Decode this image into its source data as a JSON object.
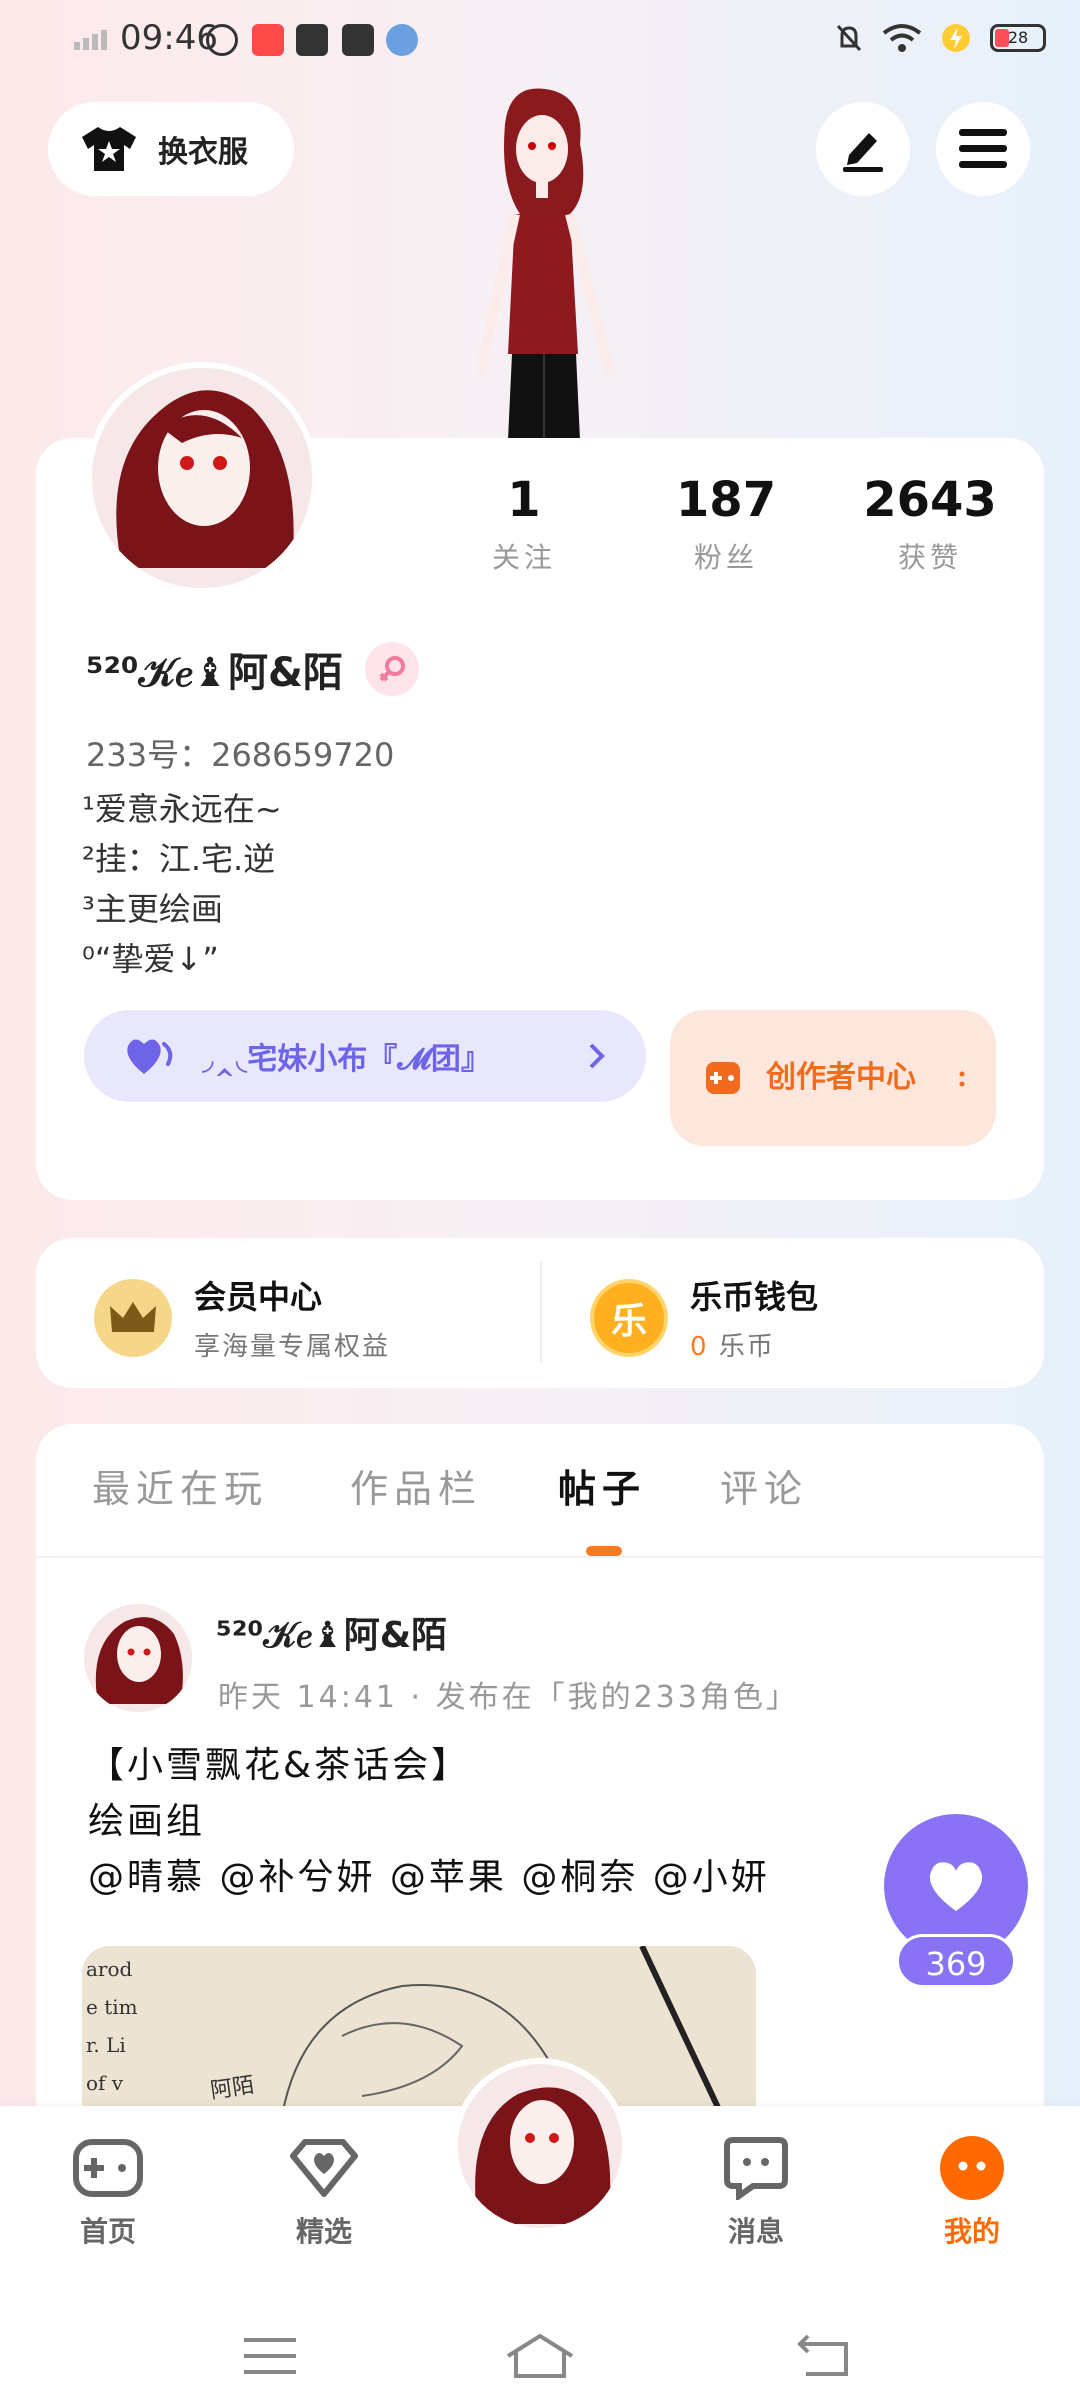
{
  "status_bar": {
    "time": "09:46",
    "battery": "28"
  },
  "header": {
    "dressup_label": "换衣服"
  },
  "profile": {
    "stats": [
      {
        "value": "1",
        "label": "关注"
      },
      {
        "value": "187",
        "label": "粉丝"
      },
      {
        "value": "2643",
        "label": "获赞"
      }
    ],
    "username": "⁵²⁰𝒦𝑒♝阿&陌",
    "uid": "233号：268659720",
    "bio": [
      "¹爱意永远在~",
      "²挂：江.宅.逆",
      "³主更绘画",
      "⁰“挚爱↓”"
    ],
    "group_label": "◞‸◟宅妹小布『𝓜团』",
    "creator_label": "创作者中心"
  },
  "member": {
    "vip_title": "会员中心",
    "vip_sub": "享海量专属权益",
    "wallet_title": "乐币钱包",
    "wallet_amount": "0",
    "wallet_unit": "乐币",
    "coin_char": "乐"
  },
  "tabs": [
    "最近在玩",
    "作品栏",
    "帖子",
    "评论"
  ],
  "post": {
    "author": "⁵²⁰𝒦𝑒♝阿&陌",
    "meta": "昨天 14:41 · 发布在「我的233角色」",
    "lines": [
      "【小雪飘花&茶话会】",
      "绘画组",
      "@晴慕 @补兮妍 @苹果 @桐奈 @小妍"
    ],
    "image_caption": "阿陌",
    "image_book_text": "arod\ne tim\nr. Li\nof v"
  },
  "fab": {
    "count": "369"
  },
  "bottom_nav": [
    "首页",
    "精选",
    "消息",
    "我的"
  ],
  "colors": {
    "accent": "#ff7a1a",
    "purple": "#8a72f5"
  }
}
